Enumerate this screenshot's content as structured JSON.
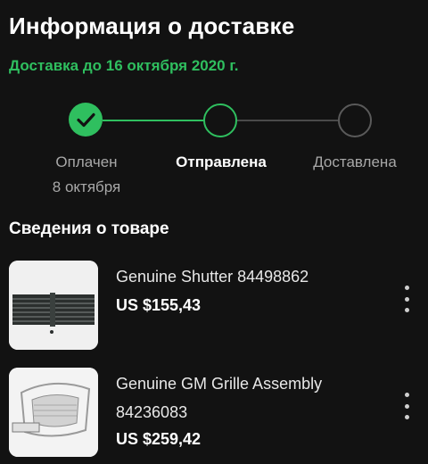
{
  "header": {
    "title": "Информация о доставке",
    "eta": "Доставка до 16 октября 2020 г."
  },
  "tracker": {
    "steps": [
      {
        "label": "Оплачен",
        "date": "8 октября",
        "state": "done"
      },
      {
        "label": "Отправлена",
        "state": "current"
      },
      {
        "label": "Доставлена",
        "state": "pending"
      }
    ],
    "colors": {
      "accent": "#2fbf5f",
      "pending": "#5a5a5a"
    },
    "icons": [
      "check-icon"
    ]
  },
  "items": {
    "title": "Сведения о товаре",
    "list": [
      {
        "name": "Genuine Shutter 84498862",
        "price": "US $155,43",
        "thumb_icon": "shutter-thumbnail",
        "menu_icon": "more-vertical-icon"
      },
      {
        "name": "Genuine GM Grille Assembly 84236083",
        "price": "US $259,42",
        "thumb_icon": "grille-thumbnail",
        "menu_icon": "more-vertical-icon"
      }
    ]
  }
}
